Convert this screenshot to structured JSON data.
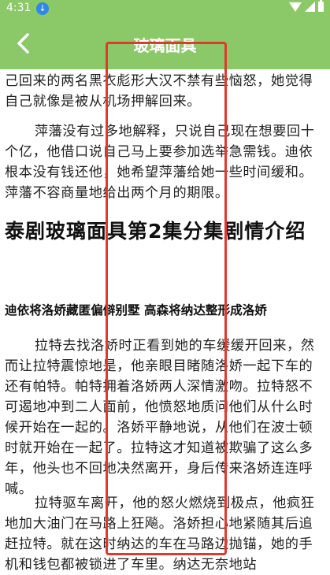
{
  "status_bar": {
    "time": "4:31",
    "download_icon": "download-icon",
    "icons": [
      "wifi-icon",
      "signal-icon",
      "battery-icon"
    ]
  },
  "app_bar": {
    "back_icon": "back-arrow-icon",
    "title": "玻璃面具"
  },
  "article": {
    "para_1": "己回来的两名黑衣彪形大汉不禁有些恼怒，她觉得自己就像是被从机场押解回来。",
    "para_2": "萍藩没有过多地解释，只说自己现在想要回十个亿，他借口说自己马上要参加选举急需钱。迪依根本没有钱还他，她希望萍藩给她一些时间缓和。萍藩不容商量地给出两个月的期限。",
    "heading": "泰剧玻璃面具第2集分集剧情介绍",
    "subheading": "迪依将洛娇藏匿偏僻别墅 高森将纳达整形成洛娇",
    "para_3": "拉特去找洛娇时正看到她的车缓缓开回来，然而让拉特震惊地是，他亲眼目睹随洛娇一起下车的还有帕特。帕特拥着洛娇两人深情激吻。拉特怒不可遏地冲到二人面前，他愤怒地质问他们从什么时候开始在一起的。洛娇平静地说，从他们在波士顿时就开始在一起了。拉特这才知道被欺骗了这么多年，他头也不回地决然离开，身后传来洛娇连连呼喊。",
    "para_4": "拉特驱车离开，他的怒火燃烧到极点，他疯狂地加大油门在马路上狂飚。洛娇担心地紧随其后追赶拉特。就在这时纳达的车在马路边抛锚，她的手机和钱包都被锁进了车里。纳达无奈地站"
  },
  "colors": {
    "app_bar": "#8bc867",
    "annotation_border": "#e03a2f"
  }
}
